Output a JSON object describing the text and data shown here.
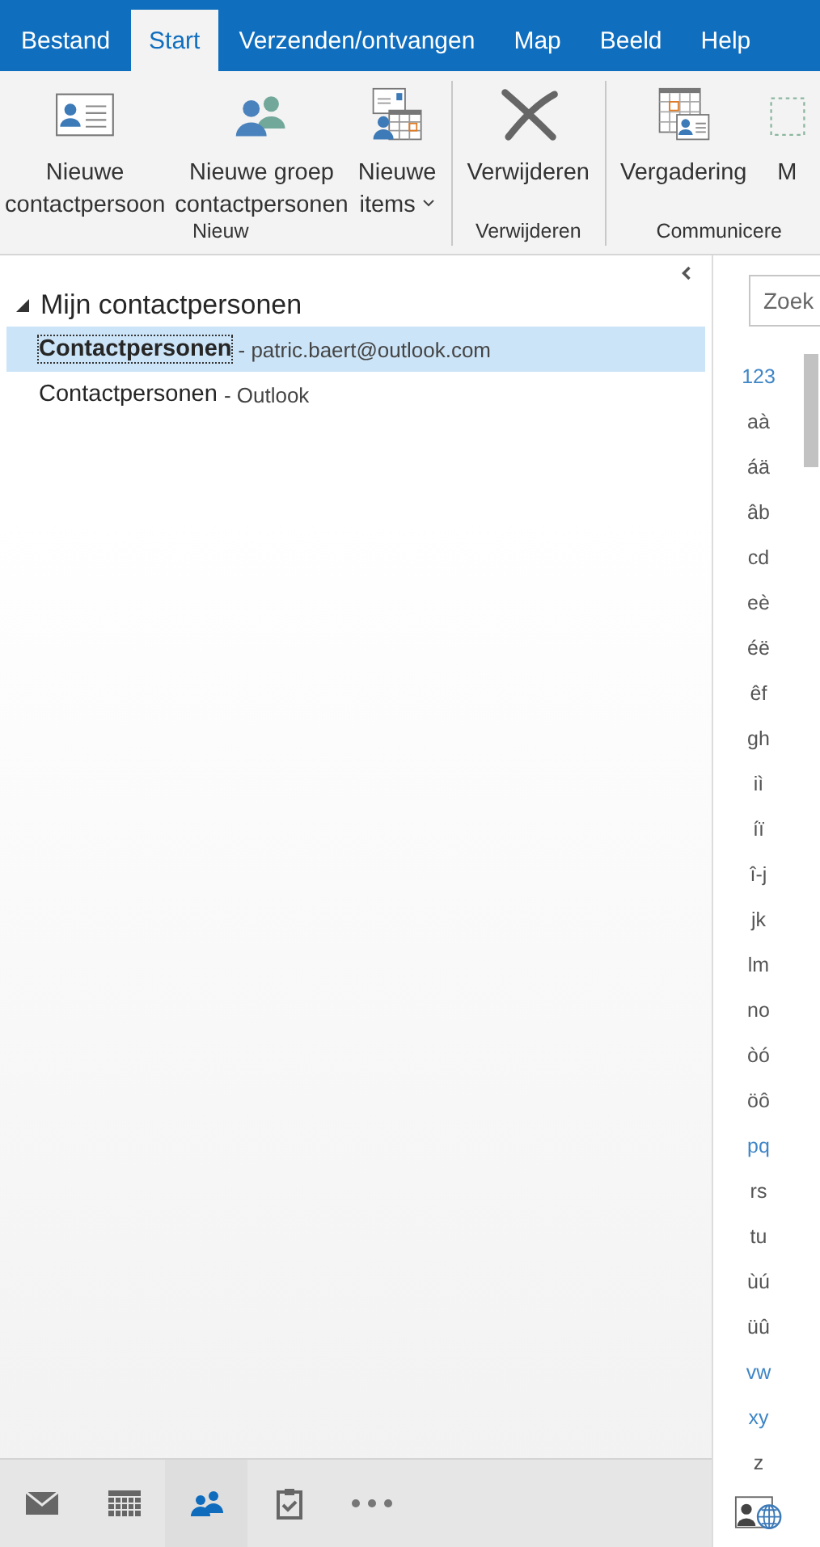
{
  "tabs": [
    {
      "label": "Bestand",
      "selected": false
    },
    {
      "label": "Start",
      "selected": true
    },
    {
      "label": "Verzenden/ontvangen",
      "selected": false
    },
    {
      "label": "Map",
      "selected": false
    },
    {
      "label": "Beeld",
      "selected": false
    },
    {
      "label": "Help",
      "selected": false
    }
  ],
  "ribbon_groups": [
    {
      "label": "Nieuw",
      "buttons": [
        {
          "kind": "card",
          "lines": [
            "Nieuwe",
            "contactpersoon"
          ],
          "dropdown": false
        },
        {
          "kind": "group",
          "lines": [
            "Nieuwe groep",
            "contactpersonen"
          ],
          "dropdown": false
        },
        {
          "kind": "items",
          "lines": [
            "Nieuwe",
            "items"
          ],
          "dropdown": true
        }
      ]
    },
    {
      "label": "Verwijderen",
      "buttons": [
        {
          "kind": "delete",
          "lines": [
            "Verwijderen"
          ],
          "dropdown": false
        }
      ]
    },
    {
      "label": "Communicere",
      "buttons": [
        {
          "kind": "meeting",
          "lines": [
            "Vergadering"
          ],
          "dropdown": false
        },
        {
          "kind": "more",
          "lines": [
            "M"
          ],
          "dropdown": false
        }
      ]
    }
  ],
  "folders": {
    "title": "Mijn contactpersonen",
    "expanded": true,
    "children": [
      {
        "name": "Contactpersonen",
        "account": "- patric.baert@outlook.com",
        "selected": true
      },
      {
        "name": "Contactpersonen",
        "account": "- Outlook",
        "selected": false
      }
    ]
  },
  "search": {
    "placeholder": "Zoek"
  },
  "index": [
    {
      "label": "123",
      "highlighted": true
    },
    {
      "label": "aà",
      "highlighted": false
    },
    {
      "label": "áä",
      "highlighted": false
    },
    {
      "label": "âb",
      "highlighted": false
    },
    {
      "label": "cd",
      "highlighted": false
    },
    {
      "label": "eè",
      "highlighted": false
    },
    {
      "label": "éë",
      "highlighted": false
    },
    {
      "label": "êf",
      "highlighted": false
    },
    {
      "label": "gh",
      "highlighted": false
    },
    {
      "label": "iì",
      "highlighted": false
    },
    {
      "label": "íï",
      "highlighted": false
    },
    {
      "label": "î-j",
      "highlighted": false
    },
    {
      "label": "jk",
      "highlighted": false
    },
    {
      "label": "lm",
      "highlighted": false
    },
    {
      "label": "no",
      "highlighted": false
    },
    {
      "label": "òó",
      "highlighted": false
    },
    {
      "label": "öô",
      "highlighted": false
    },
    {
      "label": "pq",
      "highlighted": true
    },
    {
      "label": "rs",
      "highlighted": false
    },
    {
      "label": "tu",
      "highlighted": false
    },
    {
      "label": "ùú",
      "highlighted": false
    },
    {
      "label": "üû",
      "highlighted": false
    },
    {
      "label": "vw",
      "highlighted": true
    },
    {
      "label": "xy",
      "highlighted": true
    },
    {
      "label": "z",
      "highlighted": false
    }
  ],
  "nav": [
    {
      "kind": "mail",
      "selected": false
    },
    {
      "kind": "calendar",
      "selected": false
    },
    {
      "kind": "people",
      "selected": true
    },
    {
      "kind": "tasks",
      "selected": false
    },
    {
      "kind": "more",
      "selected": false
    }
  ]
}
